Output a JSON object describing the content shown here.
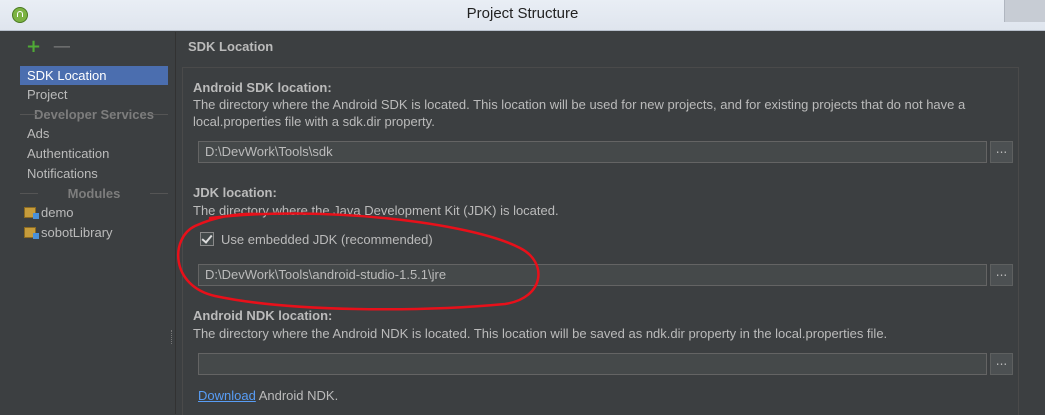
{
  "window": {
    "title": "Project Structure"
  },
  "sidebar": {
    "toolbar": {
      "add": "+",
      "remove": "—"
    },
    "items": [
      {
        "label": "SDK Location",
        "selected": true
      },
      {
        "label": "Project"
      }
    ],
    "developer_services_label": "Developer Services",
    "developer_services": [
      "Ads",
      "Authentication",
      "Notifications"
    ],
    "modules_label": "Modules",
    "modules": [
      "demo",
      "sobotLibrary"
    ]
  },
  "main": {
    "section_title": "SDK Location",
    "android_sdk": {
      "heading": "Android SDK location:",
      "description": "The directory where the Android SDK is located. This location will be used for new projects, and for existing projects that do not have a local.properties file with a sdk.dir property.",
      "path": "D:\\DevWork\\Tools\\sdk",
      "browse": "..."
    },
    "jdk": {
      "heading": "JDK location:",
      "description": "The directory where the Java Development Kit (JDK) is located.",
      "checkbox_label": "Use embedded JDK (recommended)",
      "checked": true,
      "path": "D:\\DevWork\\Tools\\android-studio-1.5.1\\jre",
      "browse": "..."
    },
    "ndk": {
      "heading": "Android NDK location:",
      "description": "The directory where the Android NDK is located. This location will be saved as ndk.dir property in the local.properties file.",
      "path": "",
      "browse": "...",
      "download_link": "Download",
      "download_suffix": " Android NDK."
    }
  },
  "colors": {
    "background": "#3c3f41",
    "selection": "#4b6eaf",
    "link": "#589df6",
    "annotation": "#e8101a"
  }
}
